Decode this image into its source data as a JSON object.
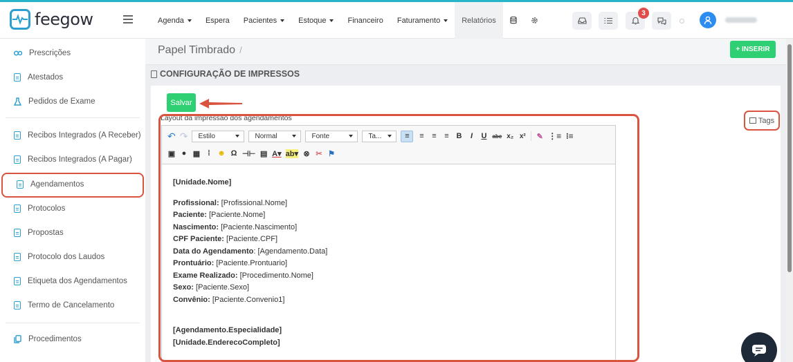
{
  "app": {
    "logo_text": "feegow"
  },
  "nav": {
    "items": [
      {
        "label": "Agenda",
        "has_caret": true
      },
      {
        "label": "Espera",
        "has_caret": false
      },
      {
        "label": "Pacientes",
        "has_caret": true
      },
      {
        "label": "Estoque",
        "has_caret": true
      },
      {
        "label": "Financeiro",
        "has_caret": false
      },
      {
        "label": "Faturamento",
        "has_caret": true
      },
      {
        "label": "Relatórios",
        "has_caret": false,
        "active": true
      }
    ],
    "notification_count": "3"
  },
  "sidebar": {
    "items": [
      {
        "label": "Prescrições",
        "icon": "pills-icon"
      },
      {
        "label": "Atestados",
        "icon": "document-icon"
      },
      {
        "label": "Pedidos de Exame",
        "icon": "flask-icon"
      },
      {
        "label": "Recibos Integrados (A Receber)",
        "icon": "document-icon"
      },
      {
        "label": "Recibos Integrados (A Pagar)",
        "icon": "document-icon"
      },
      {
        "label": "Agendamentos",
        "icon": "document-icon",
        "active": true
      },
      {
        "label": "Protocolos",
        "icon": "document-icon"
      },
      {
        "label": "Propostas",
        "icon": "document-icon"
      },
      {
        "label": "Protocolo dos Laudos",
        "icon": "document-icon"
      },
      {
        "label": "Etiqueta dos Agendamentos",
        "icon": "document-icon"
      },
      {
        "label": "Termo de Cancelamento",
        "icon": "document-icon"
      },
      {
        "label": "Procedimentos",
        "icon": "copy-icon"
      }
    ]
  },
  "header": {
    "page_title": "Papel Timbrado",
    "separator": "/",
    "insert_label": "+ INSERIR"
  },
  "section": {
    "title": "CONFIGURAÇÃO DE IMPRESSOS"
  },
  "form": {
    "save_label": "Salvar",
    "field_label": "Layout da impressão dos agendamentos",
    "tags_label": "Tags"
  },
  "editor": {
    "toolbar": {
      "style_select": "Estilo",
      "format_select": "Normal",
      "font_select": "Fonte",
      "size_select": "Ta..."
    },
    "content": {
      "heading": "[Unidade.Nome]",
      "fields": [
        {
          "label": "Profissional:",
          "value": " [Profissional.Nome]"
        },
        {
          "label": "Paciente:",
          "value": " [Paciente.Nome]"
        },
        {
          "label": "Nascimento:",
          "value": " [Paciente.Nascimento]"
        },
        {
          "label": "CPF Paciente:",
          "value": " [Paciente.CPF]"
        },
        {
          "label": "Data do Agendamento",
          "value": ": [Agendamento.Data]"
        },
        {
          "label": "Prontuário:",
          "value": " [Paciente.Prontuario]"
        },
        {
          "label": "Exame Realizado:",
          "value": " [Procedimento.Nome]"
        },
        {
          "label": "Sexo:",
          "value": " [Paciente.Sexo]"
        },
        {
          "label": "Convênio:",
          "value": " [Paciente.Convenio1]"
        }
      ],
      "footer_1": "[Agendamento.Especialidade]",
      "footer_2": "[Unidade.EnderecoCompleto]"
    }
  },
  "colors": {
    "brand": "#2a9fd0",
    "success": "#2fcf73",
    "highlight": "#d9533f",
    "badge": "#e14c4c"
  }
}
